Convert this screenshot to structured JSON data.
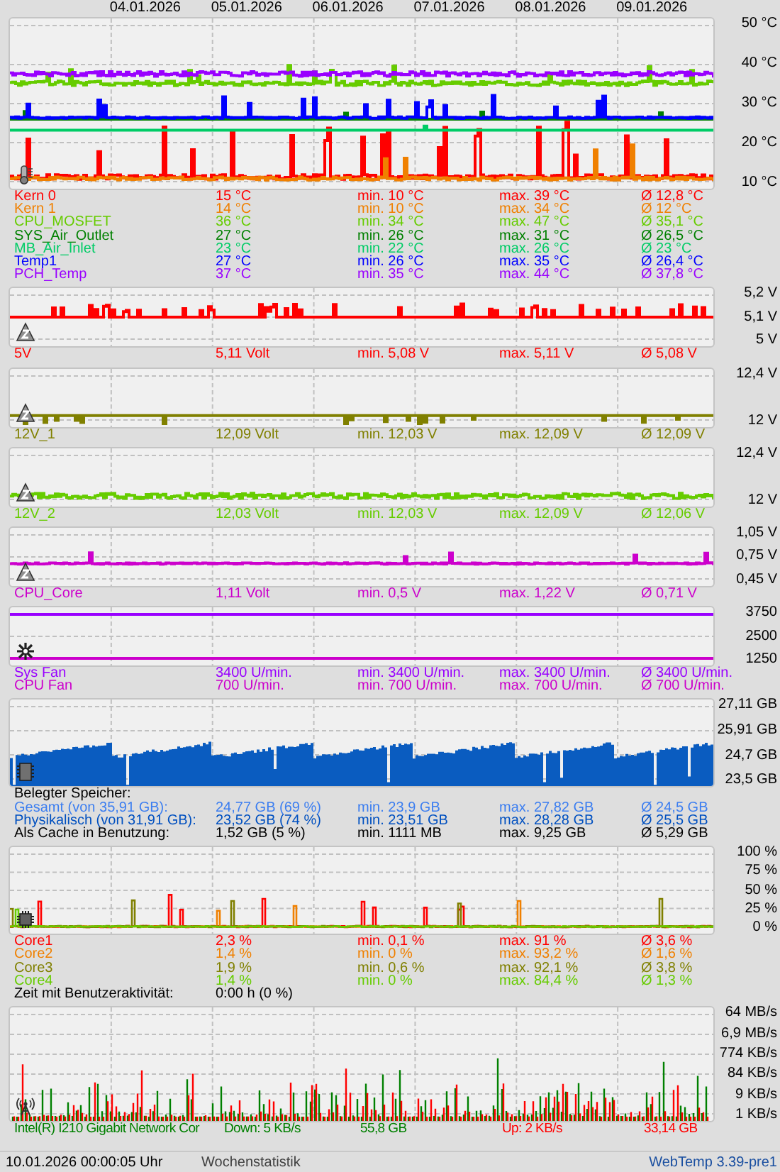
{
  "dates": [
    "04.01.2026",
    "05.01.2026",
    "06.01.2026",
    "07.01.2026",
    "08.01.2026",
    "09.01.2026"
  ],
  "panels": [
    {
      "kind": "temperature",
      "y_labels": [
        "50 °C",
        "40 °C",
        "30 °C",
        "20 °C",
        "10 °C"
      ],
      "rows": [
        {
          "color": "#ff0000",
          "cells": [
            "Kern 0",
            "15 °C",
            "min. 10 °C",
            "max. 39 °C",
            "Ø 12,8 °C"
          ]
        },
        {
          "color": "#f08000",
          "cells": [
            "Kern 1",
            "14 °C",
            "min. 10 °C",
            "max. 34 °C",
            "Ø 12 °C"
          ]
        },
        {
          "color": "#66cc00",
          "cells": [
            "CPU_MOSFET",
            "36 °C",
            "min. 34 °C",
            "max. 47 °C",
            "Ø 35,1 °C"
          ]
        },
        {
          "color": "#008000",
          "cells": [
            "SYS_Air_Outlet",
            "27 °C",
            "min. 26 °C",
            "max. 31 °C",
            "Ø 26,5 °C"
          ]
        },
        {
          "color": "#00cc66",
          "cells": [
            "MB_Air_Inlet",
            "23 °C",
            "min. 22 °C",
            "max. 26 °C",
            "Ø 23 °C"
          ]
        },
        {
          "color": "#0000ff",
          "cells": [
            "Temp1",
            "27 °C",
            "min. 26 °C",
            "max. 35 °C",
            "Ø 26,4 °C"
          ]
        },
        {
          "color": "#9900ff",
          "cells": [
            "PCH_Temp",
            "37 °C",
            "min. 35 °C",
            "max. 44 °C",
            "Ø 37,8 °C"
          ]
        }
      ]
    },
    {
      "kind": "voltage",
      "y_labels": [
        "5,2 V",
        "5,1 V",
        "5 V"
      ],
      "rows": [
        {
          "color": "#ff0000",
          "cells": [
            "5V",
            "5,11 Volt",
            "min. 5,08 V",
            "max. 5,11 V",
            "Ø 5,08 V"
          ]
        }
      ]
    },
    {
      "kind": "voltage",
      "y_labels": [
        "12,4 V",
        "12 V"
      ],
      "rows": [
        {
          "color": "#808000",
          "cells": [
            "12V_1",
            "12,09 Volt",
            "min. 12,03 V",
            "max. 12,09 V",
            "Ø 12,09 V"
          ]
        }
      ]
    },
    {
      "kind": "voltage",
      "y_labels": [
        "12,4 V",
        "12 V"
      ],
      "rows": [
        {
          "color": "#66cc00",
          "cells": [
            "12V_2",
            "12,03 Volt",
            "min. 12,03 V",
            "max. 12,09 V",
            "Ø 12,06 V"
          ]
        }
      ]
    },
    {
      "kind": "voltage",
      "y_labels": [
        "1,05 V",
        "0,75 V",
        "0,45 V"
      ],
      "rows": [
        {
          "color": "#cc00cc",
          "cells": [
            "CPU_Core",
            "1,11 Volt",
            "min. 0,5 V",
            "max. 1,22 V",
            "Ø 0,71 V"
          ]
        }
      ]
    },
    {
      "kind": "fan",
      "y_labels": [
        "3750",
        "2500",
        "1250"
      ],
      "rows": [
        {
          "color": "#9900ff",
          "cells": [
            "Sys Fan",
            "3400 U/min.",
            "min. 3400 U/min.",
            "max. 3400 U/min.",
            "Ø 3400 U/min."
          ]
        },
        {
          "color": "#cc00cc",
          "cells": [
            "CPU Fan",
            "700 U/min.",
            "min. 700 U/min.",
            "max. 700 U/min.",
            "Ø 700 U/min."
          ]
        }
      ]
    },
    {
      "kind": "memory",
      "y_labels": [
        "27,11 GB",
        "25,91 GB",
        "24,7 GB",
        "23,5 GB"
      ],
      "rows": [
        {
          "color": "#000000",
          "cells": [
            "Belegter Speicher:"
          ]
        },
        {
          "color": "#3c7ef0",
          "cells": [
            "Gesamt (von 35,91 GB):",
            "24,77 GB (69 %)",
            "min. 23,9 GB",
            "max. 27,82 GB",
            "Ø 24,5 GB"
          ]
        },
        {
          "color": "#0050c0",
          "cells": [
            "Physikalisch (von 31,91 GB):",
            "23,52 GB (74 %)",
            "min. 23,51 GB",
            "max. 28,28 GB",
            "Ø 25,5 GB"
          ]
        },
        {
          "color": "#000000",
          "cells": [
            "Als Cache in Benutzung:",
            "1,52 GB (5 %)",
            "min. 1111 MB",
            "max. 9,25 GB",
            "Ø 5,29 GB"
          ]
        }
      ]
    },
    {
      "kind": "cpu",
      "y_labels": [
        "100 %",
        "75 %",
        "50 %",
        "25 %",
        "0 %"
      ],
      "rows": [
        {
          "color": "#ff0000",
          "cells": [
            "Core1",
            "2,3 %",
            "min. 0,1 %",
            "max. 91 %",
            "Ø 3,6 %"
          ]
        },
        {
          "color": "#f08000",
          "cells": [
            "Core2",
            "1,4 %",
            "min. 0 %",
            "max. 93,2 %",
            "Ø 1,6 %"
          ]
        },
        {
          "color": "#808000",
          "cells": [
            "Core3",
            "1,9 %",
            "min. 0,6 %",
            "max. 92,1 %",
            "Ø 3,8 %"
          ]
        },
        {
          "color": "#66cc00",
          "cells": [
            "Core4",
            "1,4 %",
            "min. 0 %",
            "max. 84,4 %",
            "Ø 1,3 %"
          ]
        },
        {
          "color": "#000000",
          "cells": [
            "Zeit mit Benutzeraktivität:",
            "0:00 h (0 %)"
          ]
        }
      ]
    },
    {
      "kind": "network",
      "y_labels": [
        "64 MB/s",
        "6,9 MB/s",
        "774 KB/s",
        "84 KB/s",
        "9 KB/s",
        "1 KB/s"
      ],
      "rows": [
        {
          "color": "#008000",
          "cells": [
            "Intel(R) I210 Gigabit Network Cor",
            "Down: 5 KB/s",
            "55,8 GB",
            {
              "text": "Up: 2 KB/s",
              "color": "#ff0000"
            },
            {
              "text": "33,14 GB",
              "color": "#ff0000"
            }
          ]
        }
      ]
    }
  ],
  "footer": {
    "timestamp": "10.01.2026 00:00:05 Uhr",
    "mode": "Wochenstatistik",
    "version": "WebTemp 3.39-pre1"
  }
}
